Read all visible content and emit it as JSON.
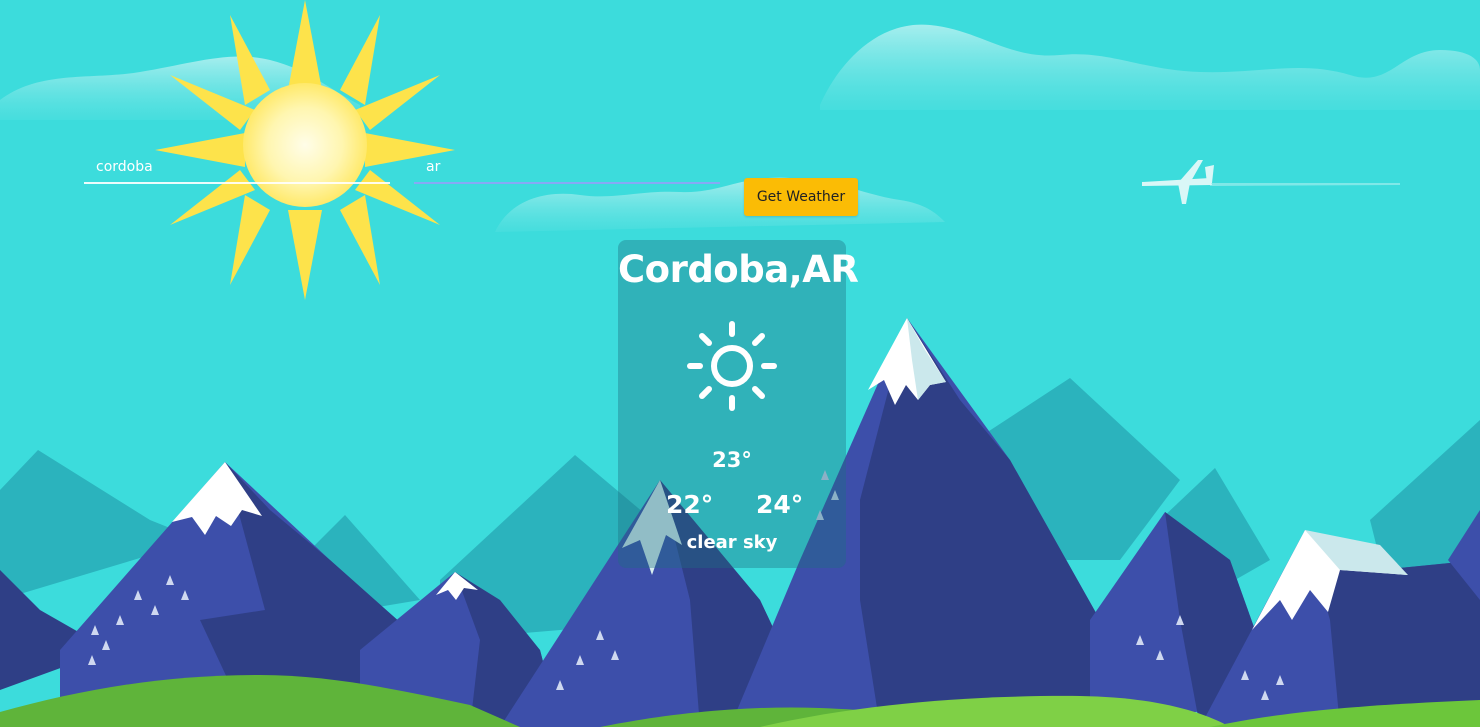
{
  "search": {
    "city_value": "cordoba",
    "country_value": "ar",
    "button_label": "Get Weather"
  },
  "weather": {
    "location": "Cordoba,AR",
    "icon": "sun-icon",
    "temp_current": "23°",
    "temp_min": "22°",
    "temp_max": "24°",
    "description": "clear sky"
  },
  "colors": {
    "sky": "#3cdcdc",
    "button": "#fbbc05",
    "mountain_blue": "#3d4faa",
    "mountain_dark": "#2f3f86",
    "grass": "#6cc63b"
  }
}
